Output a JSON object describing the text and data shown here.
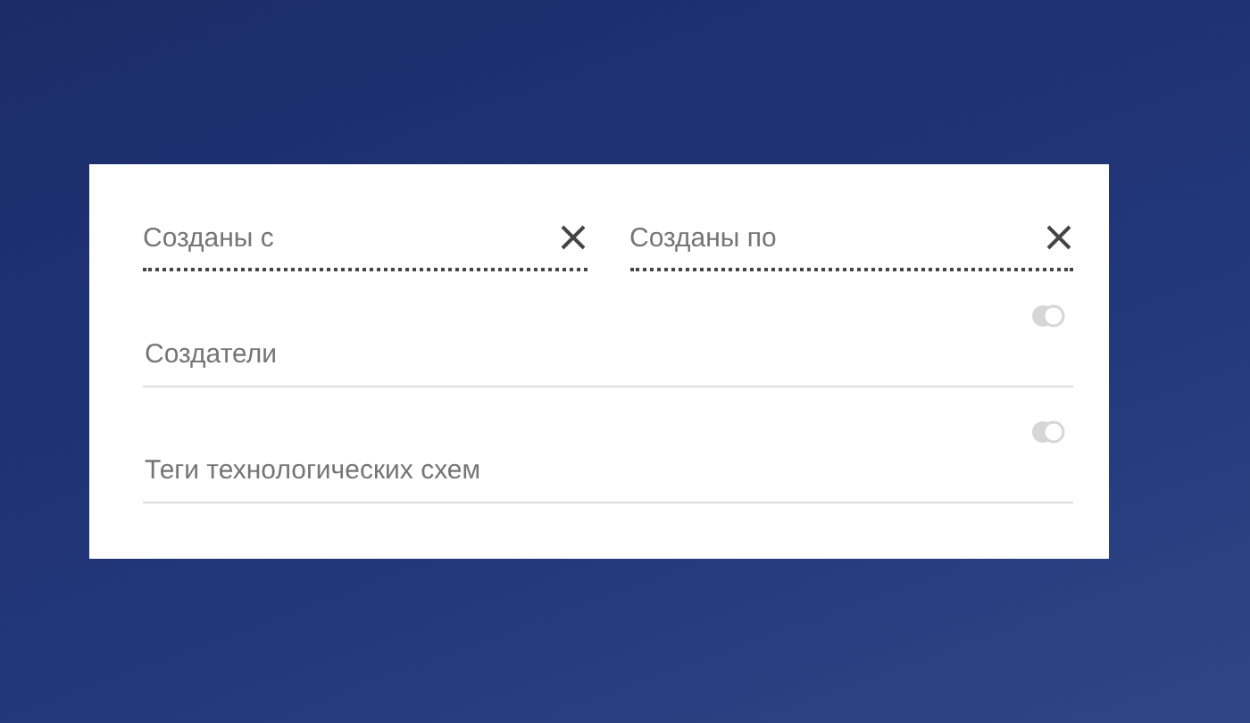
{
  "date_range": [
    {
      "placeholder": "Созданы с"
    },
    {
      "placeholder": "Созданы по"
    }
  ],
  "selects": [
    {
      "placeholder": "Создатели"
    },
    {
      "placeholder": "Теги технологических схем"
    }
  ]
}
